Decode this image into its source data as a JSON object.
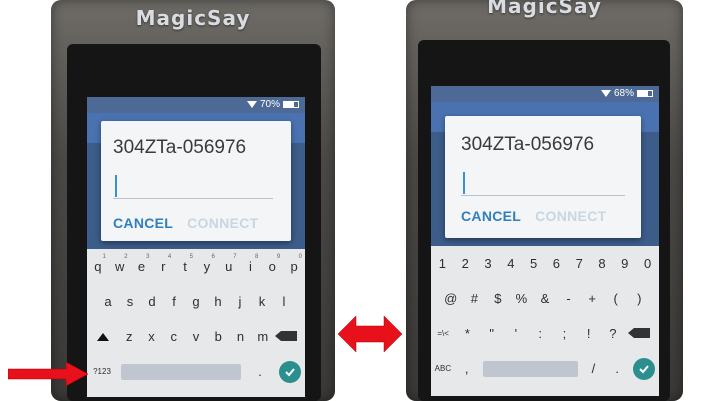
{
  "left_device": {
    "brand": "MagicSay",
    "status": {
      "battery": "70%",
      "battery_level": 0.7
    },
    "dialog": {
      "title": "304ZTa-056976",
      "cancel_label": "CANCEL",
      "connect_label": "CONNECT"
    },
    "keyboard": {
      "row1": [
        "q",
        "w",
        "e",
        "r",
        "t",
        "y",
        "u",
        "i",
        "o",
        "p"
      ],
      "row1_hints": [
        "1",
        "2",
        "3",
        "4",
        "5",
        "6",
        "7",
        "8",
        "9",
        "0"
      ],
      "row2": [
        "a",
        "s",
        "d",
        "f",
        "g",
        "h",
        "j",
        "k",
        "l"
      ],
      "row3": [
        "z",
        "x",
        "c",
        "v",
        "b",
        "n",
        "m"
      ],
      "mode_key": "?123",
      "period_key": "."
    }
  },
  "right_device": {
    "brand": "MagicSay",
    "status": {
      "battery": "68%",
      "battery_level": 0.68
    },
    "dialog": {
      "title": "304ZTa-056976",
      "cancel_label": "CANCEL",
      "connect_label": "CONNECT"
    },
    "keyboard": {
      "row1": [
        "1",
        "2",
        "3",
        "4",
        "5",
        "6",
        "7",
        "8",
        "9",
        "0"
      ],
      "row2": [
        "@",
        "#",
        "$",
        "%",
        "&",
        "-",
        "+",
        "(",
        ")"
      ],
      "row3": [
        "=\\<",
        "*",
        "\"",
        "'",
        ":",
        ";",
        "!",
        "?"
      ],
      "mode_key": "ABC",
      "comma_key": ",",
      "slash_key": "/",
      "period_key": "."
    }
  },
  "colors": {
    "arrow": "#e8101a",
    "accent": "#2f7fbf",
    "enter": "#2b8f8f"
  }
}
